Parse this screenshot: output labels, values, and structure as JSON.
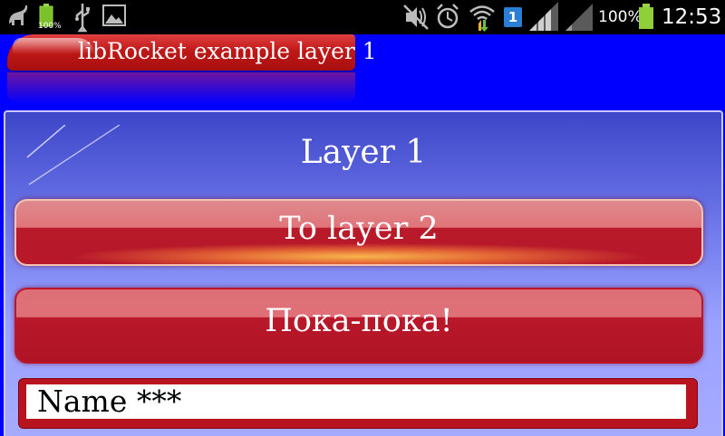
{
  "statusbar": {
    "time": "12:53",
    "battery_percent": "100%",
    "sim_badge": "1",
    "icons": [
      "bug-icon",
      "battery-icon",
      "usb-icon",
      "image-icon",
      "mute-icon",
      "alarm-icon",
      "wifi-icon",
      "sim-badge-icon",
      "signal-icon",
      "signal-icon",
      "battery-icon"
    ]
  },
  "window": {
    "title": "libRocket example layer 1"
  },
  "panel": {
    "heading": "Layer 1",
    "buttons": [
      {
        "label": "To layer 2"
      },
      {
        "label": "Пока-пока!"
      }
    ],
    "name_input": {
      "value": "Name ***"
    }
  },
  "colors": {
    "background": "#0000ff",
    "button_red": "#b8182a",
    "panel_top": "#3d46c8",
    "panel_bottom": "#a6aaff"
  }
}
